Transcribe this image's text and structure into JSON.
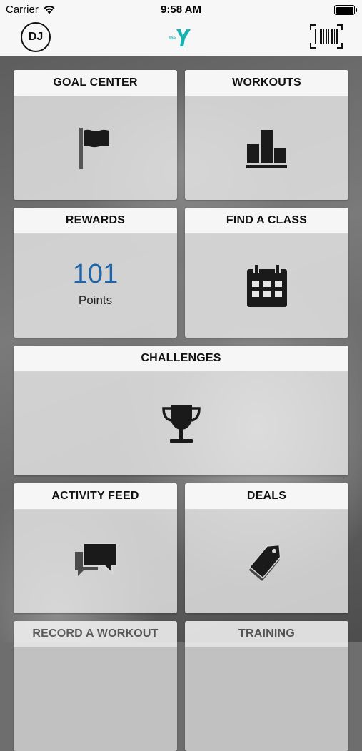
{
  "status_bar": {
    "carrier": "Carrier",
    "time": "9:58 AM"
  },
  "header": {
    "avatar_initials": "DJ",
    "logo_small_text": "the"
  },
  "tiles": {
    "goal_center": {
      "title": "GOAL CENTER"
    },
    "workouts": {
      "title": "WORKOUTS"
    },
    "rewards": {
      "title": "REWARDS",
      "points_value": "101",
      "points_label": "Points"
    },
    "find_a_class": {
      "title": "FIND A CLASS"
    },
    "challenges": {
      "title": "CHALLENGES"
    },
    "activity_feed": {
      "title": "ACTIVITY FEED"
    },
    "deals": {
      "title": "DEALS"
    },
    "record_a_workout": {
      "title": "RECORD A WORKOUT"
    },
    "training": {
      "title": "TRAINING"
    }
  },
  "colors": {
    "accent_blue": "#1f63a8",
    "logo_teal": "#18b4b4",
    "icon": "#1a1a1a"
  }
}
